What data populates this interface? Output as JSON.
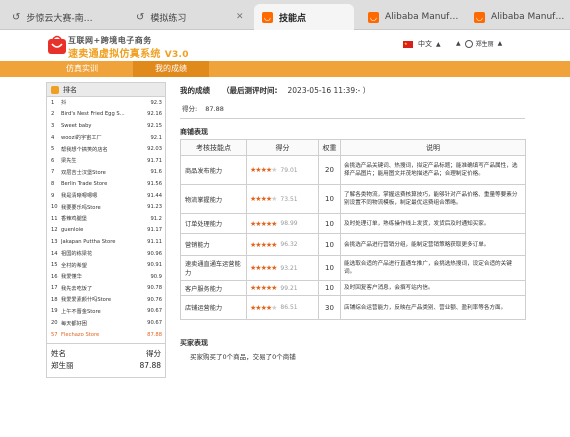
{
  "browser": {
    "tabs": [
      {
        "label": "步惊云大赛-南…",
        "icon": "page-icon",
        "active": false
      },
      {
        "label": "模拟练习",
        "icon": "page-icon",
        "active": false
      },
      {
        "label": "技能点",
        "icon": "alibaba-icon",
        "active": true
      },
      {
        "label": "Alibaba Manuf…",
        "icon": "alibaba-icon",
        "active": false
      },
      {
        "label": "Alibaba Manuf…",
        "icon": "alibaba-icon",
        "active": false
      }
    ]
  },
  "header": {
    "logo_line1": "互联网+跨境电子商务",
    "logo_line2": "速卖通虚拟仿真系统",
    "version": "V3.0",
    "language": "中文",
    "user": "郑生丽"
  },
  "nav": {
    "items": [
      {
        "label": "仿真实训"
      },
      {
        "label": "我的成绩"
      }
    ],
    "active_index": 1
  },
  "ranking": {
    "title": "排名",
    "rows": [
      {
        "no": "1",
        "name": "抖",
        "score": "92.3"
      },
      {
        "no": "2",
        "name": "Bird's Nest Fried Egg S...",
        "score": "92.16"
      },
      {
        "no": "3",
        "name": "Sweet baby",
        "score": "92.15"
      },
      {
        "no": "4",
        "name": "woozi的宇宙工厂",
        "score": "92.1"
      },
      {
        "no": "5",
        "name": "帮我想个搞笑的店名",
        "score": "92.03"
      },
      {
        "no": "6",
        "name": "梁先生",
        "score": "91.71"
      },
      {
        "no": "7",
        "name": "双层吉士汉堡Store",
        "score": "91.6"
      },
      {
        "no": "8",
        "name": "Berlin Trade Store",
        "score": "91.56"
      },
      {
        "no": "9",
        "name": "我是清晰嗯嗯嗯",
        "score": "91.44"
      },
      {
        "no": "10",
        "name": "我要要乐吗Store",
        "score": "91.23"
      },
      {
        "no": "11",
        "name": "香辣鸡腿堡",
        "score": "91.2"
      },
      {
        "no": "12",
        "name": "guenloie",
        "score": "91.17"
      },
      {
        "no": "13",
        "name": "Jakapan Puttha Store",
        "score": "91.11"
      },
      {
        "no": "14",
        "name": "祖国的栋梁花",
        "score": "90.96"
      },
      {
        "no": "15",
        "name": "全村的希望",
        "score": "90.91"
      },
      {
        "no": "16",
        "name": "我爱懂华",
        "score": "90.9"
      },
      {
        "no": "17",
        "name": "我先去吃饭了",
        "score": "90.78"
      },
      {
        "no": "18",
        "name": "我爱爱素颜什吗Store",
        "score": "90.76"
      },
      {
        "no": "19",
        "name": "上午不晋金Store",
        "score": "90.67"
      },
      {
        "no": "20",
        "name": "每天都好困",
        "score": "90.67"
      },
      {
        "no": "57",
        "name": "Flechazo Store",
        "score": "87.88",
        "highlight": true
      }
    ],
    "footer_name_label": "姓名",
    "footer_score_label": "得分",
    "footer_name": "郑生丽",
    "footer_score": "87.88"
  },
  "result": {
    "title": "我的成绩",
    "latest_label": "（最后测评时间:",
    "latest_time": "2023-05-16 11:39:- ）",
    "score_label": "得分:",
    "score_value": "87.88"
  },
  "shop": {
    "title": "商铺表现",
    "columns": [
      "考核技能点",
      "得分",
      "权重",
      "说明"
    ],
    "rows": [
      {
        "name": "商品发布能力",
        "stars": 4,
        "score": "79.01",
        "weight": "20",
        "desc": "会挑选产品关键词、热搜词，拟定产品标题；能准确填写产品属性，选择产品图片；能用图文并茂地描述产品；合理制定价格。"
      },
      {
        "name": "物流掌握能力",
        "stars": 3.5,
        "score": "73.51",
        "weight": "10",
        "desc": "了解各类物流，掌握运费核算技巧，能够针对产品价格、重量等要素分别设置不同物流模板，制定最优运费组合策略。"
      },
      {
        "name": "订单处理能力",
        "stars": 5,
        "score": "98.99",
        "weight": "10",
        "desc": "及时处理订单，熟练操作线上发货，发货后及时通知买家。"
      },
      {
        "name": "营销能力",
        "stars": 5,
        "score": "96.32",
        "weight": "10",
        "desc": "会挑选产品进行营销分组，能制定营销策略获取更多订单。"
      },
      {
        "name": "速卖通直通车运营能力",
        "stars": 5,
        "score": "93.21",
        "weight": "10",
        "desc": "能选取合适的产品进行直通车推广，会挑选热搜词，设定合适的关键词。"
      },
      {
        "name": "客户服务能力",
        "stars": 5,
        "score": "99.21",
        "weight": "10",
        "desc": "及时回复客户消息，会撰写站内信。"
      },
      {
        "name": "店铺运营能力",
        "stars": 4,
        "score": "86.51",
        "weight": "30",
        "desc": "店铺综合运营能力，反映在产品类别、营业额、盈利率等各方面。"
      }
    ]
  },
  "buyer": {
    "title": "买家表现",
    "text": "买家购买了0个商品，交易了0个商铺"
  },
  "colors": {
    "accent_orange": "#f0a33a",
    "star_on": "#e0641c",
    "highlight_rank": "#e0641c"
  }
}
